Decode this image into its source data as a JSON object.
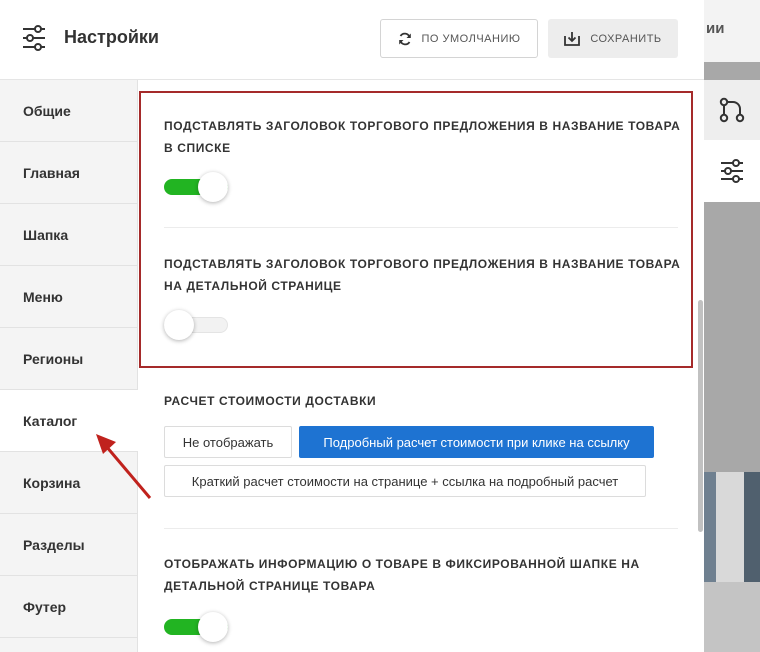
{
  "header": {
    "title": "Настройки",
    "default_button": "ПО УМОЛЧАНИЮ",
    "save_button": "СОХРАНИТЬ"
  },
  "backdrop": {
    "fragment": "ии"
  },
  "sidebar": {
    "items": [
      {
        "label": "Общие"
      },
      {
        "label": "Главная"
      },
      {
        "label": "Шапка"
      },
      {
        "label": "Меню"
      },
      {
        "label": "Регионы"
      },
      {
        "label": "Каталог",
        "active": true
      },
      {
        "label": "Корзина"
      },
      {
        "label": "Разделы"
      },
      {
        "label": "Футер"
      }
    ]
  },
  "settings": {
    "offer_title_in_list": {
      "label": "ПОДСТАВЛЯТЬ ЗАГОЛОВОК ТОРГОВОГО ПРЕДЛОЖЕНИЯ В НАЗВАНИЕ ТОВАРА В СПИСКЕ",
      "enabled": true
    },
    "offer_title_in_detail": {
      "label": "ПОДСТАВЛЯТЬ ЗАГОЛОВОК ТОРГОВОГО ПРЕДЛОЖЕНИЯ В НАЗВАНИЕ ТОВАРА НА ДЕТАЛЬНОЙ СТРАНИЦЕ",
      "enabled": false
    },
    "delivery_calc": {
      "label": "РАСЧЕТ СТОИМОСТИ ДОСТАВКИ",
      "options": [
        "Не отображать",
        "Подробный расчет стоимости при клике на ссылку",
        "Краткий расчет стоимости на странице + ссылка на подробный расчет"
      ],
      "selected": "Подробный расчет стоимости при клике на ссылку"
    },
    "fixed_header_info": {
      "label": "ОТОБРАЖАТЬ ИНФОРМАЦИЮ О ТОВАРЕ В ФИКСИРОВАННОЙ ШАПКЕ НА ДЕТАЛЬНОЙ СТРАНИЦЕ ТОВАРА",
      "enabled": true
    }
  },
  "icons": {
    "header": "sliders-icon",
    "default_button": "refresh-icon",
    "save_button": "download-icon",
    "tool_a": "branches-icon",
    "tool_b": "sliders-icon",
    "annotation": "red-arrow"
  },
  "colors": {
    "accent": "#1e73d2",
    "toggle_on": "#22b422",
    "highlight_border": "#a52a2a",
    "annotation_arrow": "#c0221d"
  }
}
